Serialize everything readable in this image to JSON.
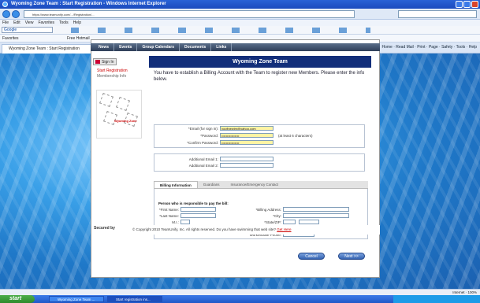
{
  "window": {
    "title": "Wyoming Zone Team : Start Registration - Windows Internet Explorer"
  },
  "browser": {
    "address": "https://www.teamunify.com/.../Registration/...",
    "menu": [
      "File",
      "Edit",
      "View",
      "Favorites",
      "Tools",
      "Help"
    ],
    "google_label": "Google",
    "favorites_label": "Favorites",
    "free_hotmail": "Free Hotmail",
    "tab_title": "Wyoming Zone Team : Start Registration",
    "cmd": "Home  ·  Read Mail  ·  Print  ·  Page  ·  Safety  ·  Tools  ·  Help"
  },
  "site": {
    "nav": [
      "News",
      "Events",
      "Group Calendars",
      "Documents",
      "Links"
    ],
    "sign_in": "Sign In",
    "side_links": [
      "Start Registration",
      "Membership Info"
    ],
    "doodle_label": "Wyoming Zone",
    "heading": "Wyoming Zone Team",
    "intro": "You have to establish a Billing Account with the Team to register new Members. Please enter the info below.",
    "account": {
      "email_label": "*Email (for sign in):",
      "email_value": "yoofinewim@yahoo.com",
      "password_label": "*Password:",
      "password_value": "••••••••••••••••",
      "confirm_label": "*Confirm Password:",
      "confirm_value": "••••••••••••••••",
      "hint": "(at least 6 characters)"
    },
    "additional": {
      "email1": "Additional Email 1:",
      "email2": "Additional Email 2:"
    },
    "tabs": [
      "Billing Information",
      "Guardians",
      "Insurance/Emergency Contact"
    ],
    "billing": {
      "responsible": "Person who is responsible to pay the bill:",
      "first": "*First Name:",
      "last": "*Last Name:",
      "mi": "M.I.:",
      "address": "*Billing Address:",
      "city": "*City:",
      "state": "*State/ZIP:",
      "home": "*Home Phone:",
      "work": "Work/Mobile Phone:"
    },
    "cancel": "Cancel",
    "next": "Next >>",
    "footer_logo": "Secured by",
    "footer": "© Copyright 2010 TeamUnify, Inc. All rights reserved.   Do you have swimming that web site?",
    "footer_link": "Get Here"
  },
  "status": {
    "zone": "Internet",
    "zoom": "100%"
  },
  "taskbar": {
    "start": "start",
    "items": [
      "Wyoming Zone Team ...",
      "Start registration ins..."
    ]
  }
}
